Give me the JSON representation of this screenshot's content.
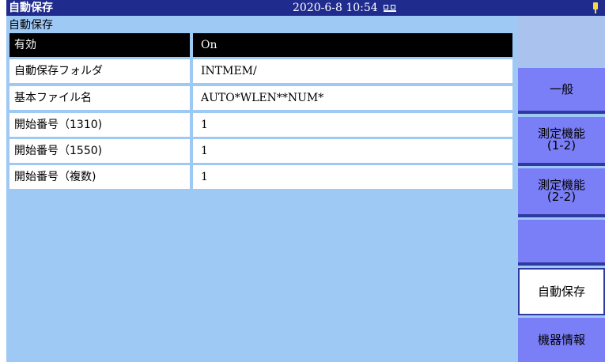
{
  "titlebar": {
    "app_title": "自動保存",
    "datetime": "2020-6-8 10:54",
    "pc_icon": "pc-connection-icon",
    "power_icon": "power-plug-icon"
  },
  "panel": {
    "title": "自動保存",
    "rows": [
      {
        "label": "有効",
        "value": "On"
      },
      {
        "label": "自動保存フォルダ",
        "value": "INTMEM/"
      },
      {
        "label": "基本ファイル名",
        "value": "AUTO*WLEN**NUM*"
      },
      {
        "label": "開始番号（1310)",
        "value": "1"
      },
      {
        "label": "開始番号（1550)",
        "value": "1"
      },
      {
        "label": "開始番号（複数)",
        "value": "1"
      }
    ]
  },
  "softkeys": {
    "general": "一般",
    "measure1_line1": "測定機能",
    "measure1_line2": "(1-2)",
    "measure2_line1": "測定機能",
    "measure2_line2": "(2-2)",
    "autosave": "自動保存",
    "device_info": "機器情報"
  },
  "colors": {
    "titlebar": "#1f2c8e",
    "background": "#9fc9f5",
    "softkey": "#7b7ff7",
    "selected_row": "#000000"
  }
}
